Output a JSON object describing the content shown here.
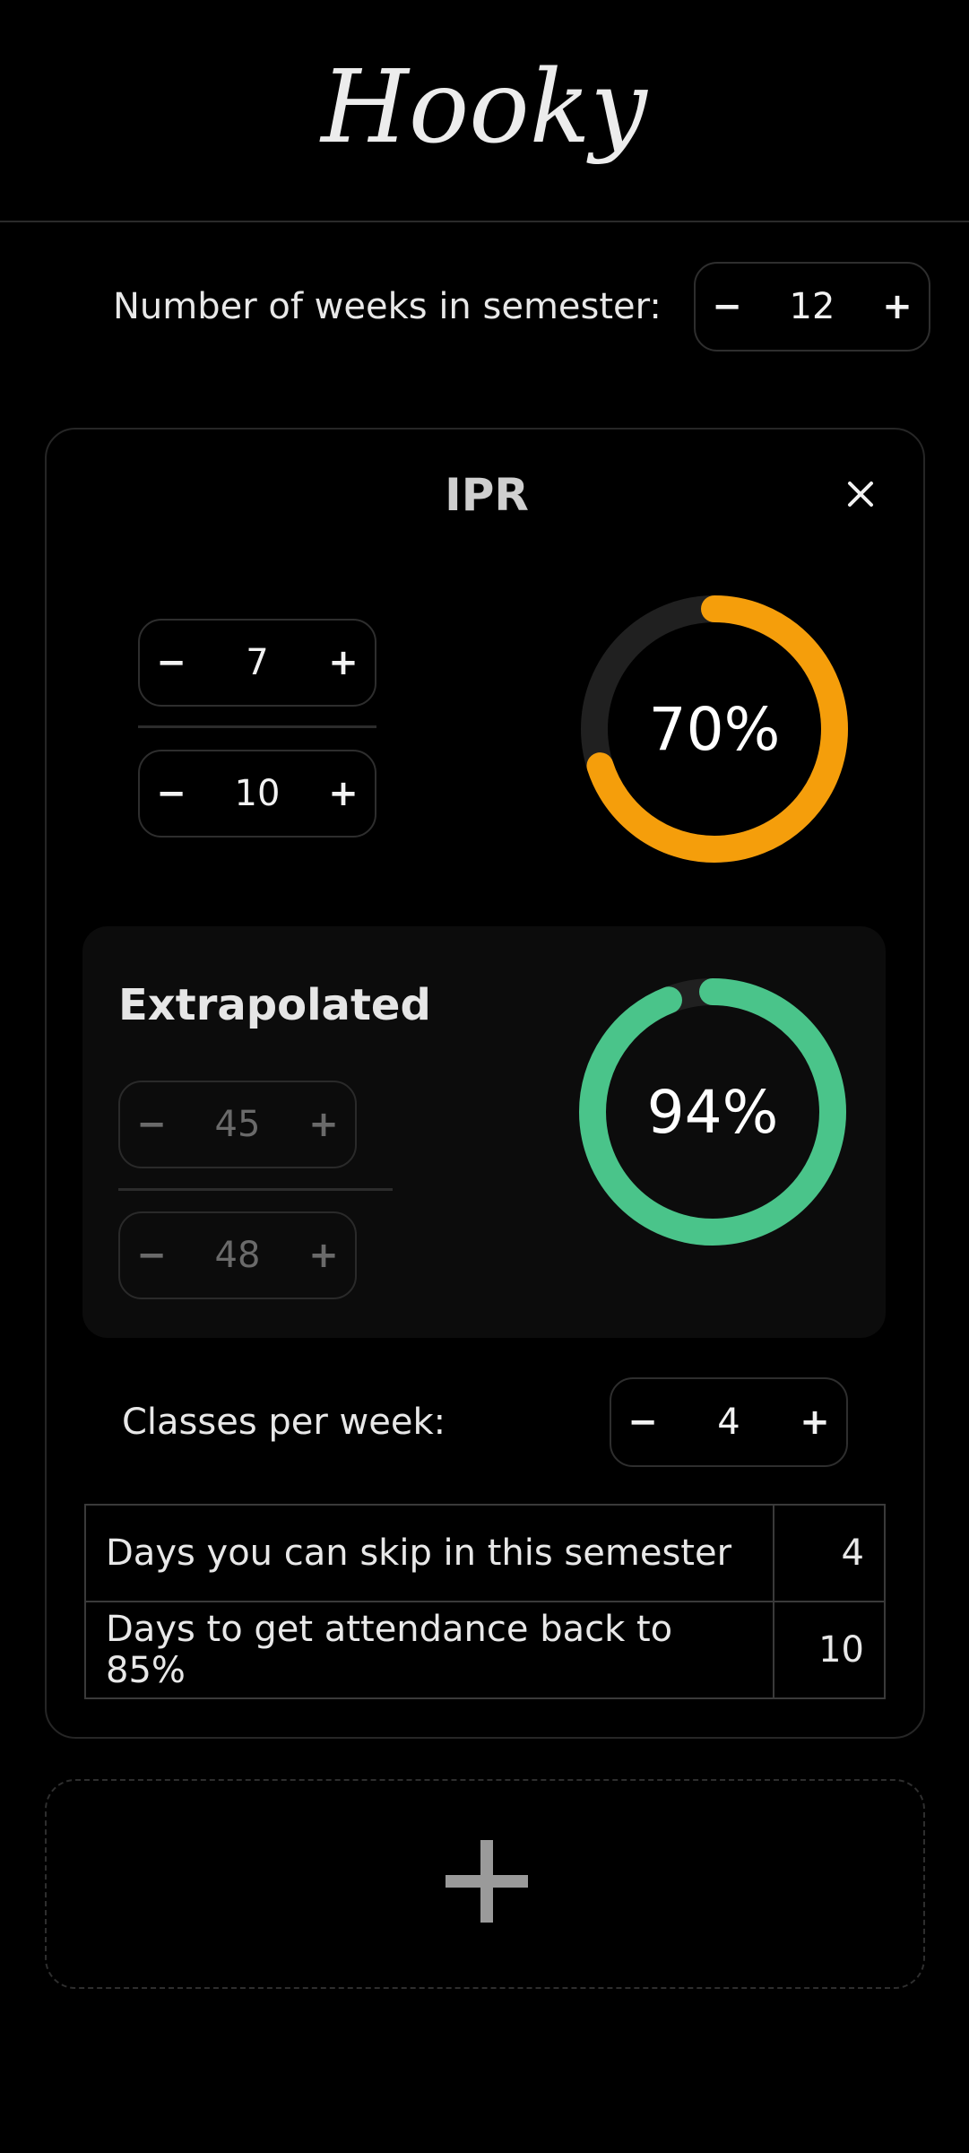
{
  "app": {
    "title": "Hooky"
  },
  "semester": {
    "label": "Number of weeks in semester:",
    "weeks": "12"
  },
  "controls": {
    "minus": "−",
    "plus": "+"
  },
  "subject": {
    "name": "IPR",
    "attended": "7",
    "total": "10",
    "percent_label": "70%",
    "percent": 0.7,
    "ring_color": "#f59e0b",
    "extrapolated": {
      "title": "Extrapolated",
      "attended": "45",
      "total": "48",
      "percent_label": "94%",
      "percent": 0.94,
      "ring_color": "#4ac48a"
    },
    "classes_per_week_label": "Classes per week:",
    "classes_per_week": "4",
    "stats": [
      {
        "label": "Days you can skip in this semester",
        "value": "4"
      },
      {
        "label": "Days to get attendance back to 85%",
        "value": "10"
      }
    ]
  },
  "icons": {
    "close": "close-icon",
    "add": "plus-icon"
  }
}
